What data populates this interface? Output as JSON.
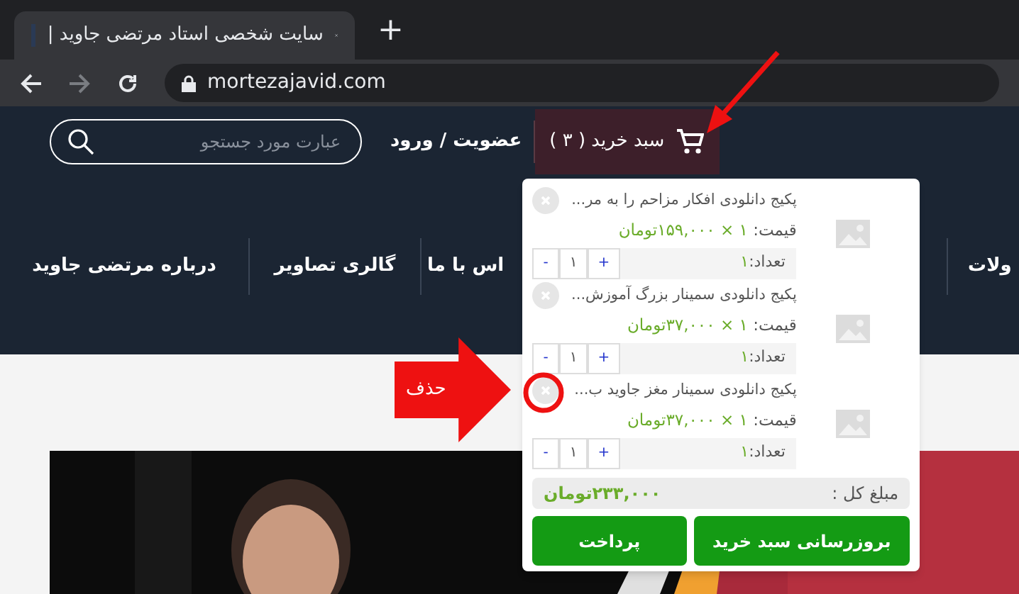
{
  "browser": {
    "tab_title": "سایت شخصی استاد مرتضی جاوید |",
    "new_tab": "+",
    "url": "mortezajavid.com"
  },
  "header": {
    "cart_button": "سبد خرید ( ۳ )",
    "login_link": "عضویت / ورود",
    "search": {
      "placeholder": "عبارت مورد جستجو"
    }
  },
  "nav": [
    "ولات",
    "اس با ما",
    "گالری تصاویر",
    "درباره مرتضی جاوید"
  ],
  "cart": {
    "items": [
      {
        "title": "پکیج دانلودی افکار مزاحم را به مر...",
        "price_label": "قیمت:",
        "price": "۱ × ۱۵۹,۰۰۰تومان",
        "qty_label": "تعداد:",
        "qty": "۱",
        "qty_value": "۱",
        "plus": "+",
        "minus": "-"
      },
      {
        "title": "پکیج دانلودی سمینار بزرگ آموزش...",
        "price_label": "قیمت:",
        "price": "۱ × ۳۷,۰۰۰تومان",
        "qty_label": "تعداد:",
        "qty": "۱",
        "qty_value": "۱",
        "plus": "+",
        "minus": "-"
      },
      {
        "title": "پکیج دانلودی سمینار مغز جاوید ب...",
        "price_label": "قیمت:",
        "price": "۱ × ۳۷,۰۰۰تومان",
        "qty_label": "تعداد:",
        "qty": "۱",
        "qty_value": "۱",
        "plus": "+",
        "minus": "-"
      }
    ],
    "total_label": "مبلغ کل :",
    "total": "۲۳۳,۰۰۰تومان",
    "buttons": [
      "بروزرسانی سبد خرید",
      "پرداخت"
    ]
  },
  "annotation": {
    "label": "حذف"
  }
}
